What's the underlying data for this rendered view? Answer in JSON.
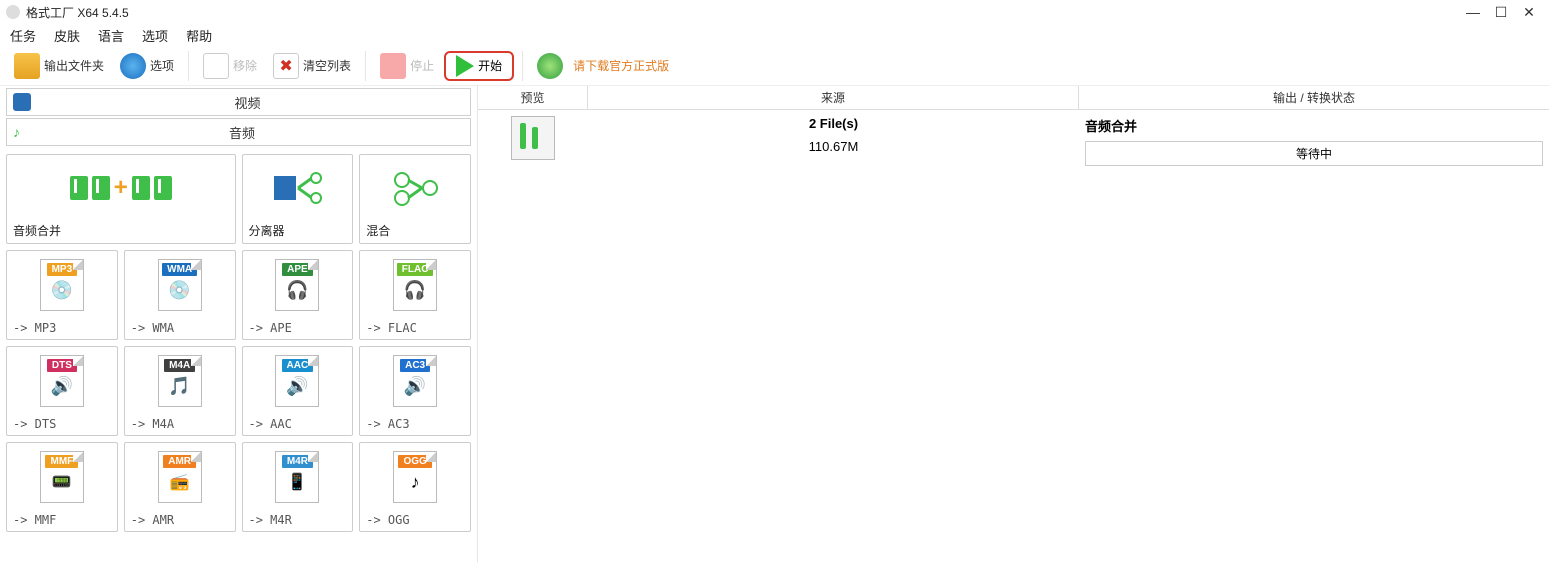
{
  "window": {
    "title": "格式工厂 X64 5.4.5"
  },
  "menu": {
    "task": "任务",
    "skin": "皮肤",
    "language": "语言",
    "option": "选项",
    "help": "帮助"
  },
  "toolbar": {
    "output_folder": "输出文件夹",
    "options": "选项",
    "remove": "移除",
    "clear_list": "清空列表",
    "stop": "停止",
    "start": "开始",
    "download_official": "请下载官方正式版"
  },
  "categories": {
    "video": "视频",
    "audio": "音频"
  },
  "tiles": {
    "audio_join": "音频合并",
    "splitter": "分离器",
    "mix": "混合",
    "mp3": "-> MP3",
    "wma": "-> WMA",
    "ape": "-> APE",
    "flac": "-> FLAC",
    "dts": "-> DTS",
    "m4a": "-> M4A",
    "aac": "-> AAC",
    "ac3": "-> AC3",
    "mmf": "-> MMF",
    "amr": "-> AMR",
    "m4r": "-> M4R",
    "ogg": "-> OGG"
  },
  "badges": {
    "mp3": "MP3",
    "wma": "WMA",
    "ape": "APE",
    "flac": "FLAC",
    "dts": "DTS",
    "m4a": "M4A",
    "aac": "AAC",
    "ac3": "AC3",
    "mmf": "MMF",
    "amr": "AMR",
    "m4r": "M4R",
    "ogg": "OGG"
  },
  "badge_colors": {
    "mp3": "#f0a020",
    "wma": "#1a6fbf",
    "ape": "#2f8f3f",
    "flac": "#6fbf2f",
    "dts": "#d03060",
    "m4a": "#404040",
    "aac": "#1a8fcf",
    "ac3": "#2070d0",
    "mmf": "#f0a020",
    "amr": "#f07f20",
    "m4r": "#2f8fcf",
    "ogg": "#f07f20"
  },
  "columns": {
    "preview": "预览",
    "source": "来源",
    "output_status": "输出 / 转换状态"
  },
  "task_row": {
    "file_count": "2 File(s)",
    "size": "110.67M",
    "output_name": "音频合并",
    "status": "等待中"
  }
}
